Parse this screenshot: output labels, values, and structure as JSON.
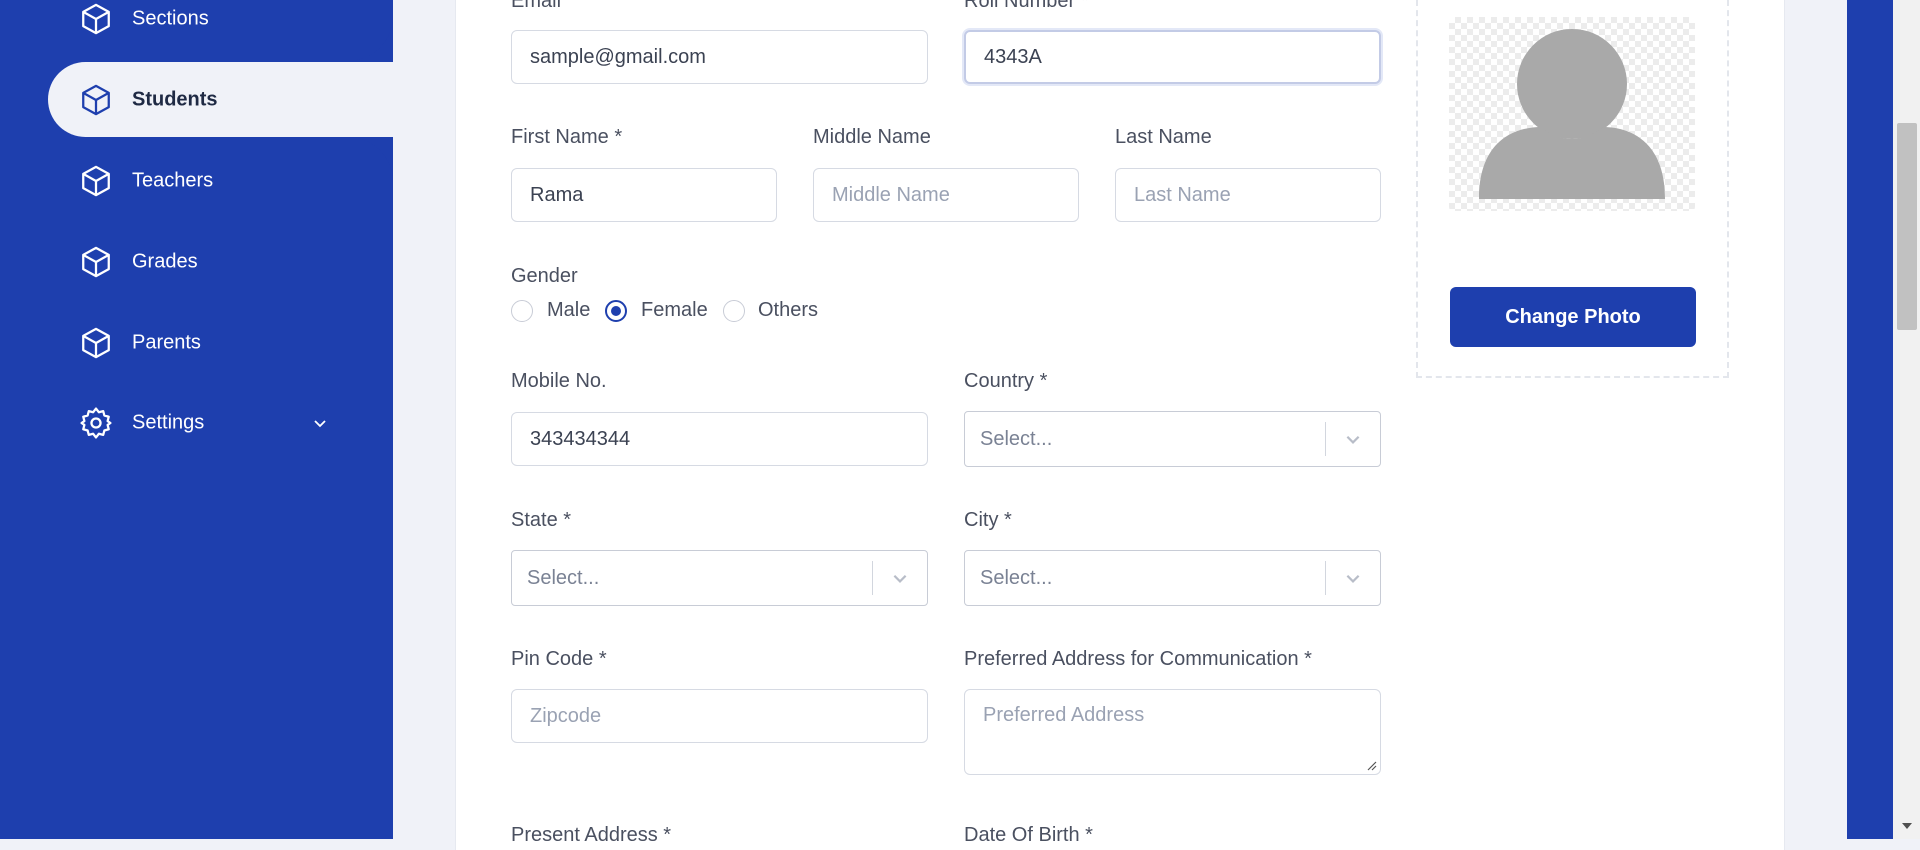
{
  "sidebar": {
    "items": [
      {
        "label": "Sections",
        "icon": "cube-icon"
      },
      {
        "label": "Students",
        "icon": "cube-icon",
        "active": true
      },
      {
        "label": "Teachers",
        "icon": "cube-icon"
      },
      {
        "label": "Grades",
        "icon": "cube-icon"
      },
      {
        "label": "Parents",
        "icon": "cube-icon"
      },
      {
        "label": "Settings",
        "icon": "gear-icon",
        "expandable": true
      }
    ]
  },
  "form": {
    "email": {
      "label": "Email",
      "value": "sample@gmail.com"
    },
    "roll_number": {
      "label": "Roll Number *",
      "value": "4343A"
    },
    "first_name": {
      "label": "First Name *",
      "value": "Rama"
    },
    "middle_name": {
      "label": "Middle Name",
      "placeholder": "Middle Name"
    },
    "last_name": {
      "label": "Last Name",
      "placeholder": "Last Name"
    },
    "gender": {
      "label": "Gender",
      "options": [
        "Male",
        "Female",
        "Others"
      ],
      "selected": "Female"
    },
    "mobile": {
      "label": "Mobile No.",
      "value": "343434344"
    },
    "country": {
      "label": "Country *",
      "placeholder": "Select..."
    },
    "state": {
      "label": "State *",
      "placeholder": "Select..."
    },
    "city": {
      "label": "City *",
      "placeholder": "Select..."
    },
    "pin_code": {
      "label": "Pin Code *",
      "placeholder": "Zipcode"
    },
    "preferred_address": {
      "label": "Preferred Address for Communication *",
      "placeholder": "Preferred Address"
    },
    "present_address": {
      "label": "Present Address *"
    },
    "date_of_birth": {
      "label": "Date Of Birth *"
    }
  },
  "photo": {
    "button_label": "Change Photo"
  },
  "colors": {
    "primary": "#1e3fae",
    "background": "#f0f2f8"
  }
}
